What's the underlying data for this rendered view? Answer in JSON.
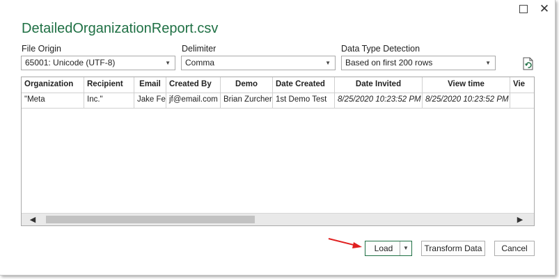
{
  "window": {
    "title": "DetailedOrganizationReport.csv",
    "maximize_icon": "maximize-icon",
    "close_glyph": "✕"
  },
  "options": {
    "file_origin": {
      "label": "File Origin",
      "value": "65001: Unicode (UTF-8)"
    },
    "delimiter": {
      "label": "Delimiter",
      "value": "Comma"
    },
    "data_type_detection": {
      "label": "Data Type Detection",
      "value": "Based on first 200 rows"
    },
    "refresh_icon": "refresh-document-icon"
  },
  "preview": {
    "headers": [
      "Organization",
      "Recipient",
      "Email",
      "Created By",
      "Demo",
      "Date Created",
      "Date Invited",
      "View time",
      "Vie"
    ],
    "rows": [
      [
        "\"Meta",
        "Inc.\"",
        "Jake Fever",
        "jf@email.com",
        "Brian Zurcher",
        "1st Demo Test",
        "8/25/2020 10:23:52 PM",
        "8/25/2020 10:23:52 PM",
        ""
      ]
    ]
  },
  "buttons": {
    "load": "Load",
    "transform": "Transform Data",
    "cancel": "Cancel"
  },
  "colors": {
    "accent": "#1f7044",
    "annotation_arrow": "#e02020"
  }
}
